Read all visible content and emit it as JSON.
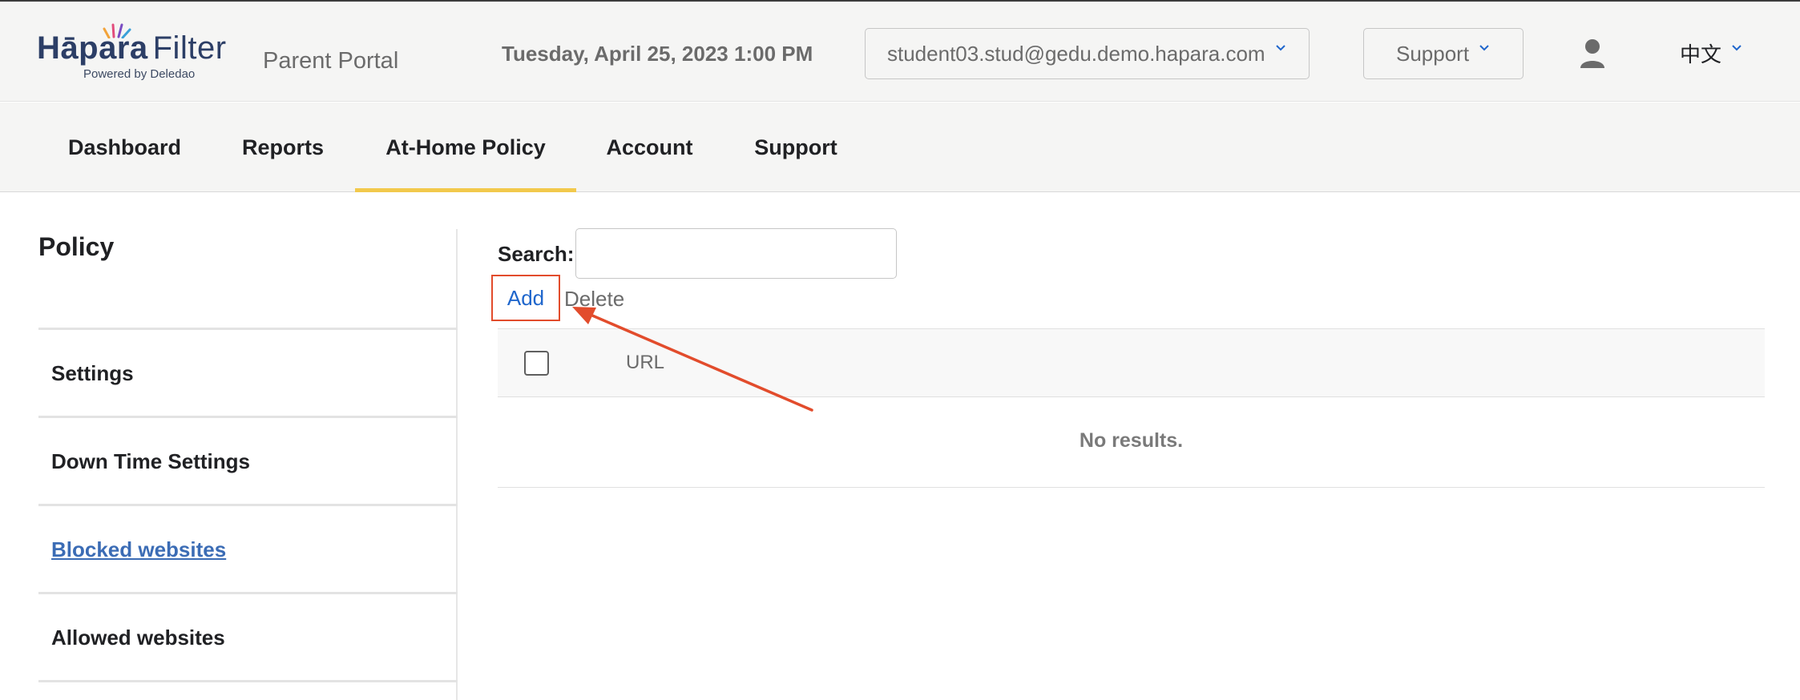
{
  "brand": {
    "logo_word_1": "Hāpara",
    "logo_word_2": "Filter",
    "logo_sub": "Powered by Deledao",
    "portal_title": "Parent Portal"
  },
  "header": {
    "datetime": "Tuesday, April 25, 2023 1:00 PM",
    "student_select": "student03.stud@gedu.demo.hapara.com",
    "support_select": "Support",
    "language": "中文",
    "icons": {
      "chevron": "chevron-down-icon",
      "user": "user-icon"
    }
  },
  "nav": {
    "tabs": [
      {
        "label": "Dashboard",
        "active": false
      },
      {
        "label": "Reports",
        "active": false
      },
      {
        "label": "At-Home Policy",
        "active": true
      },
      {
        "label": "Account",
        "active": false
      },
      {
        "label": "Support",
        "active": false
      }
    ]
  },
  "sidebar": {
    "title": "Policy",
    "items": [
      {
        "label": "Settings"
      },
      {
        "label": "Down Time Settings"
      },
      {
        "label": "Blocked websites",
        "selected": true
      },
      {
        "label": "Allowed websites"
      }
    ]
  },
  "main": {
    "search_label": "Search:",
    "search_value": "",
    "add_label": "Add",
    "delete_label": "Delete",
    "table": {
      "columns": [
        "URL"
      ],
      "empty_text": "No results."
    }
  },
  "colors": {
    "accent_underline": "#f2c94c",
    "link_blue": "#1f66cc",
    "annotation_red": "#e24c2c"
  }
}
